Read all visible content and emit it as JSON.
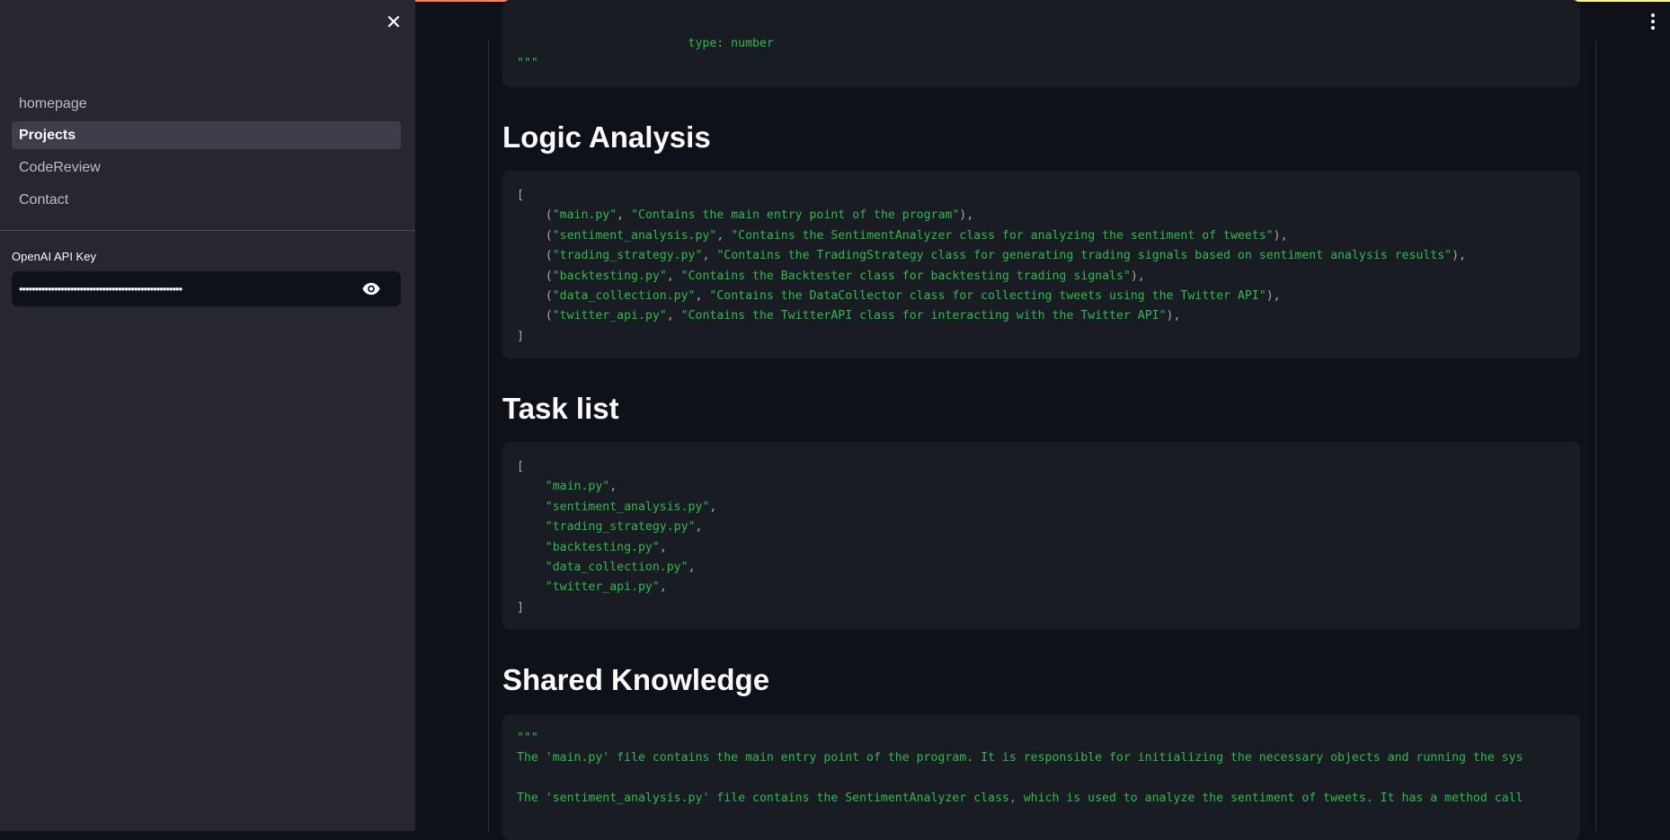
{
  "sidebar": {
    "close_icon": "close-icon",
    "nav": [
      {
        "label": "homepage",
        "active": false
      },
      {
        "label": "Projects",
        "active": true
      },
      {
        "label": "CodeReview",
        "active": false
      },
      {
        "label": "Contact",
        "active": false
      }
    ],
    "api_key_label": "OpenAI API Key",
    "api_key_value": "sk-xxxxxxxxxxxxxxxxxxxxxxxxxxxxxxxxxxxxxxxxxxxxxxxx",
    "eye_icon": "eye-icon"
  },
  "header": {
    "menu_icon": "kebab-menu-icon"
  },
  "colors": {
    "sidebar_bg": "#262730",
    "main_bg": "#0e1117",
    "code_bg": "#1a1c24",
    "string": "#2bbc4a",
    "accent_top": "#ff4b4b"
  },
  "main": {
    "top_block": {
      "lines": [
        "                        type: number",
        "\"\"\""
      ]
    },
    "sections": [
      {
        "title": "Logic Analysis",
        "lines": [
          "[",
          "    (\"main.py\", \"Contains the main entry point of the program\"),",
          "    (\"sentiment_analysis.py\", \"Contains the SentimentAnalyzer class for analyzing the sentiment of tweets\"),",
          "    (\"trading_strategy.py\", \"Contains the TradingStrategy class for generating trading signals based on sentiment analysis results\"),",
          "    (\"backtesting.py\", \"Contains the Backtester class for backtesting trading signals\"),",
          "    (\"data_collection.py\", \"Contains the DataCollector class for collecting tweets using the Twitter API\"),",
          "    (\"twitter_api.py\", \"Contains the TwitterAPI class for interacting with the Twitter API\"),",
          "]"
        ]
      },
      {
        "title": "Task list",
        "lines": [
          "[",
          "    \"main.py\",",
          "    \"sentiment_analysis.py\",",
          "    \"trading_strategy.py\",",
          "    \"backtesting.py\",",
          "    \"data_collection.py\",",
          "    \"twitter_api.py\",",
          "]"
        ]
      },
      {
        "title": "Shared Knowledge",
        "lines": [
          "\"\"\"",
          "The 'main.py' file contains the main entry point of the program. It is responsible for initializing the necessary objects and running the sys",
          "",
          "The 'sentiment_analysis.py' file contains the SentimentAnalyzer class, which is used to analyze the sentiment of tweets. It has a method call"
        ]
      }
    ]
  }
}
